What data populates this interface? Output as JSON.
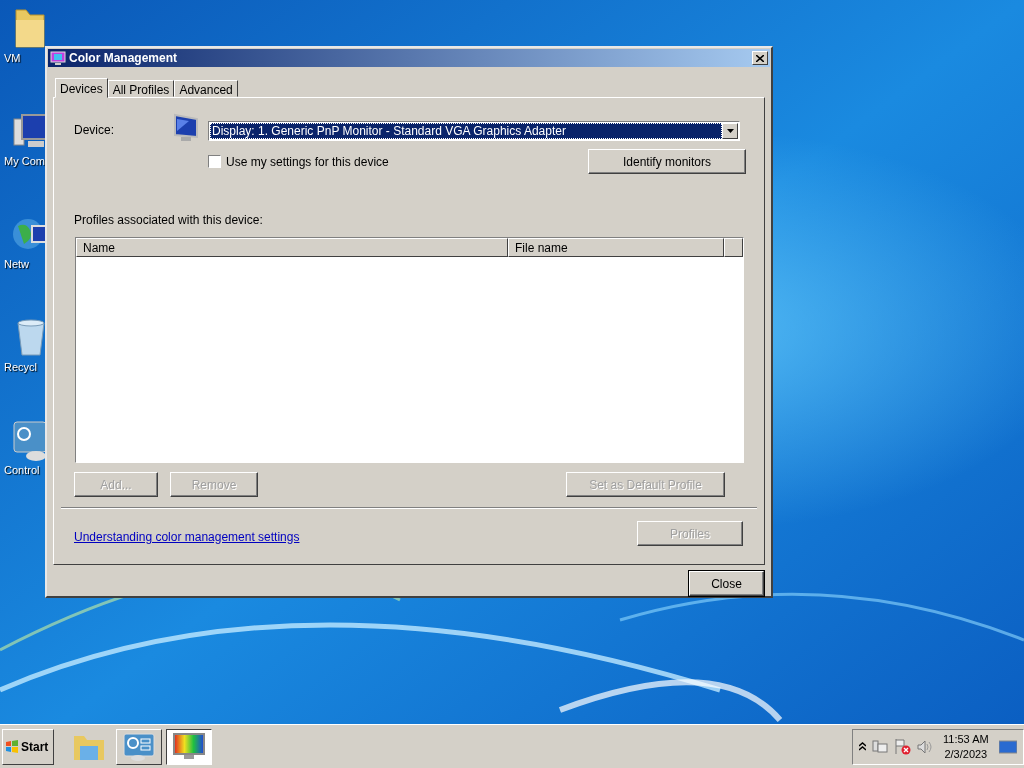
{
  "desktop_icons": [
    {
      "kind": "folder",
      "label": "VM"
    },
    {
      "kind": "computer",
      "label": "My Com"
    },
    {
      "kind": "network",
      "label": "Netw"
    },
    {
      "kind": "recycle",
      "label": "Recycl"
    },
    {
      "kind": "control",
      "label": "Control"
    }
  ],
  "window": {
    "title": "Color Management"
  },
  "tabs": [
    {
      "label": "Devices",
      "selected": true
    },
    {
      "label": "All Profiles",
      "selected": false
    },
    {
      "label": "Advanced",
      "selected": false
    }
  ],
  "device": {
    "label": "Device:",
    "value": "Display: 1. Generic PnP Monitor - Standard VGA Graphics Adapter"
  },
  "use_my_settings": {
    "label": "Use my settings for this device",
    "checked": false
  },
  "identify_button": {
    "label": "Identify monitors",
    "disabled": false
  },
  "profiles_label": "Profiles associated with this device:",
  "table": {
    "columns": [
      "Name",
      "File name"
    ]
  },
  "profile_buttons": [
    {
      "label": "Add...",
      "disabled": true
    },
    {
      "label": "Remove",
      "disabled": true
    },
    {
      "label": "Set as Default Profile",
      "disabled": true
    }
  ],
  "link": "Understanding color management settings",
  "profiles_button": {
    "label": "Profiles",
    "disabled": true
  },
  "close_button": {
    "label": "Close",
    "disabled": false
  },
  "taskbar": {
    "start": "Start",
    "items": [
      {
        "kind": "explorer",
        "selected": false
      },
      {
        "kind": "control-panel",
        "selected": false
      },
      {
        "kind": "color",
        "selected": true
      }
    ],
    "clock": {
      "time": "11:53 AM",
      "date": "2/3/2023"
    }
  }
}
